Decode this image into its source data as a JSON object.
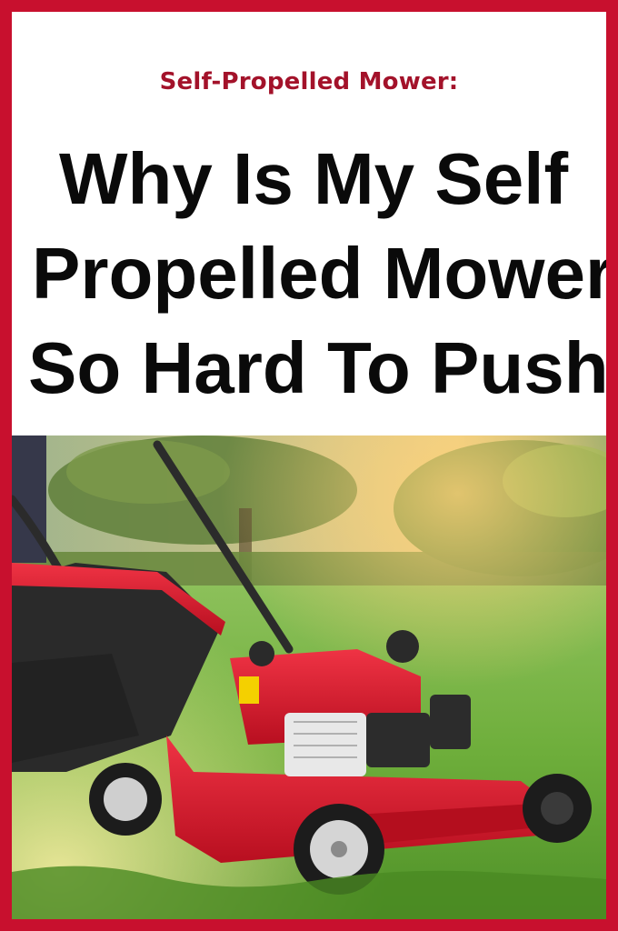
{
  "article": {
    "kicker": "Self-Propelled Mower:",
    "headline_lines": [
      "Why  Is My Self",
      "Propelled Mower",
      "So Hard To Push"
    ]
  },
  "colors": {
    "frame": "#c8102e",
    "kicker": "#a3122a",
    "headline": "#0a0a0a",
    "grass": "#6fae3a",
    "mower_red": "#d8192b"
  },
  "photo": {
    "subject": "red self-propelled lawn mower on green grass"
  }
}
